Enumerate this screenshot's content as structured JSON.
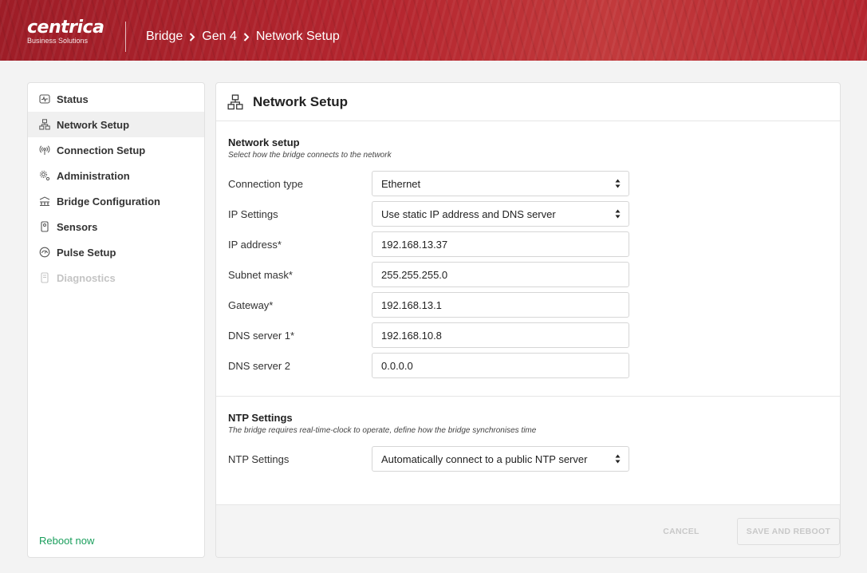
{
  "header": {
    "logo_name": "centrica",
    "logo_sub": "Business Solutions",
    "breadcrumb": [
      "Bridge",
      "Gen 4",
      "Network Setup"
    ],
    "background_color": "#b0242f"
  },
  "sidebar": {
    "items": [
      {
        "label": "Status",
        "icon": "activity-icon",
        "state": "normal"
      },
      {
        "label": "Network Setup",
        "icon": "network-icon",
        "state": "active"
      },
      {
        "label": "Connection Setup",
        "icon": "antenna-icon",
        "state": "normal"
      },
      {
        "label": "Administration",
        "icon": "gears-icon",
        "state": "normal"
      },
      {
        "label": "Bridge Configuration",
        "icon": "bridge-icon",
        "state": "normal"
      },
      {
        "label": "Sensors",
        "icon": "sensor-icon",
        "state": "normal"
      },
      {
        "label": "Pulse Setup",
        "icon": "gauge-icon",
        "state": "normal"
      },
      {
        "label": "Diagnostics",
        "icon": "diagnostics-icon",
        "state": "disabled"
      }
    ],
    "reboot_label": "Reboot now",
    "reboot_color": "#1a9e5c"
  },
  "main": {
    "title": "Network Setup",
    "title_icon": "network-icon",
    "network": {
      "title": "Network setup",
      "description": "Select how the bridge connects to the network",
      "fields": [
        {
          "label": "Connection type",
          "value": "Ethernet",
          "kind": "select"
        },
        {
          "label": "IP Settings",
          "value": "Use static IP address and DNS server",
          "kind": "select"
        },
        {
          "label": "IP address*",
          "value": "192.168.13.37",
          "kind": "input"
        },
        {
          "label": "Subnet mask*",
          "value": "255.255.255.0",
          "kind": "input"
        },
        {
          "label": "Gateway*",
          "value": "192.168.13.1",
          "kind": "input"
        },
        {
          "label": "DNS server 1*",
          "value": "192.168.10.8",
          "kind": "input"
        },
        {
          "label": "DNS server 2",
          "value": "0.0.0.0",
          "kind": "input"
        }
      ]
    },
    "ntp": {
      "title": "NTP Settings",
      "description": "The bridge requires real-time-clock to operate, define how the bridge synchronises time",
      "fields": [
        {
          "label": "NTP Settings",
          "value": "Automatically connect to a public NTP server",
          "kind": "select"
        }
      ]
    },
    "footer": {
      "cancel_label": "CANCEL",
      "save_label": "SAVE AND REBOOT"
    }
  }
}
